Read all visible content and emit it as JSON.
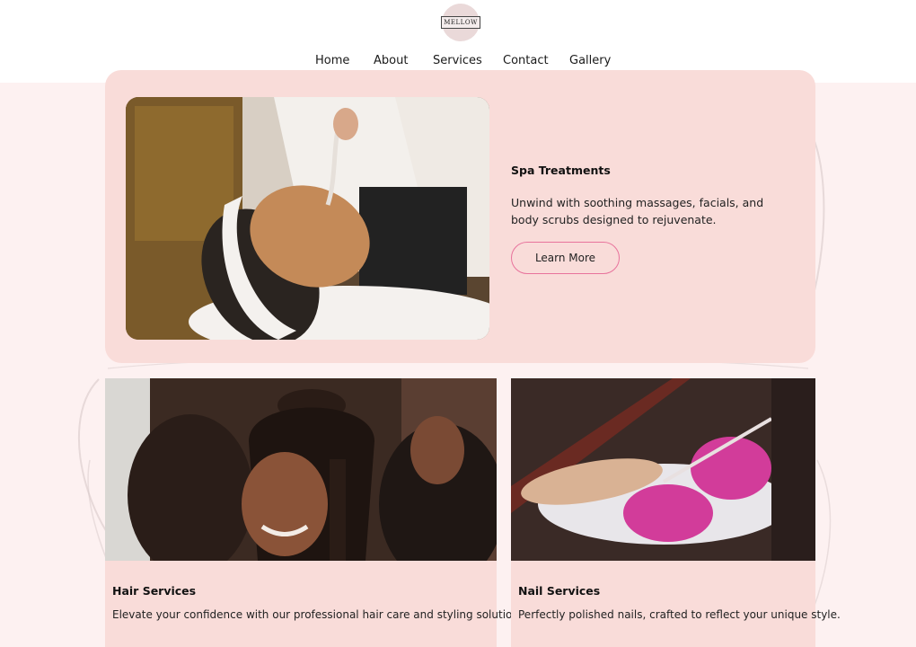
{
  "brand": {
    "logo_text": "MELLOW",
    "accent": "#e8739c",
    "card_bg": "#f9dcd9",
    "page_bg": "#fdf1f1"
  },
  "nav": {
    "items": [
      {
        "label": "Home"
      },
      {
        "label": "About"
      },
      {
        "label": "Services"
      },
      {
        "label": "Contact"
      },
      {
        "label": "Gallery"
      }
    ]
  },
  "services": {
    "spa": {
      "title": "Spa Treatments",
      "description": "Unwind with soothing massages, facials, and body scrubs designed to rejuvenate.",
      "button_label": "Learn More",
      "image": "spa-facial-photo"
    },
    "hair": {
      "title": "Hair Services",
      "description": "Elevate your confidence with our professional hair care and styling solutions.",
      "image": "braided-hair-photo"
    },
    "nail": {
      "title": "Nail Services",
      "description": "Perfectly polished nails, crafted to reflect your unique style.",
      "image": "manicure-photo"
    }
  }
}
